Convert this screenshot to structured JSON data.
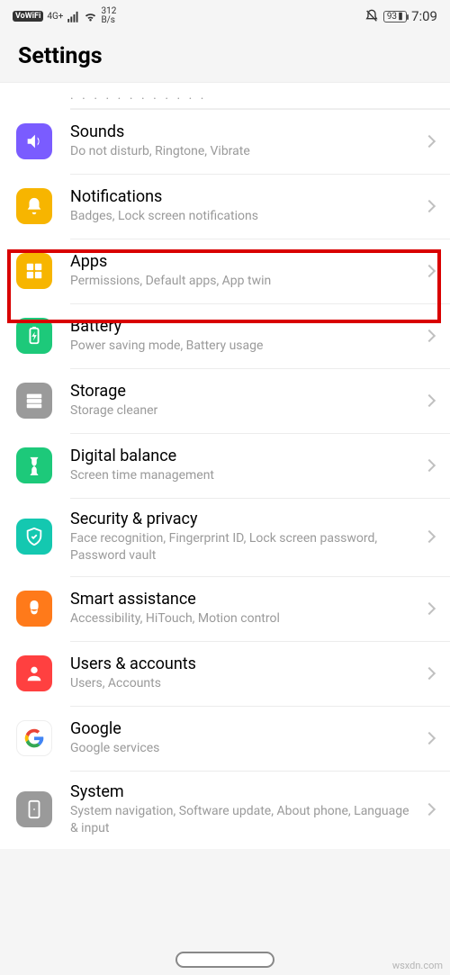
{
  "status": {
    "vowifi": "VoWiFi",
    "net": "4G+",
    "speed_num": "312",
    "speed_unit": "B/s",
    "battery": "93",
    "time": "7:09"
  },
  "header": {
    "title": "Settings"
  },
  "rows": [
    {
      "title": "Sounds",
      "sub": "Do not disturb, Ringtone, Vibrate",
      "color": "#7a5cff"
    },
    {
      "title": "Notifications",
      "sub": "Badges, Lock screen notifications",
      "color": "#f7b500"
    },
    {
      "title": "Apps",
      "sub": "Permissions, Default apps, App twin",
      "color": "#f7b500"
    },
    {
      "title": "Battery",
      "sub": "Power saving mode, Battery usage",
      "color": "#1dc97a"
    },
    {
      "title": "Storage",
      "sub": "Storage cleaner",
      "color": "#9a9a9a"
    },
    {
      "title": "Digital balance",
      "sub": "Screen time management",
      "color": "#1dc97a"
    },
    {
      "title": "Security & privacy",
      "sub": "Face recognition, Fingerprint ID, Lock screen password, Password vault",
      "color": "#14c8b0"
    },
    {
      "title": "Smart assistance",
      "sub": "Accessibility, HiTouch, Motion control",
      "color": "#ff7a1a"
    },
    {
      "title": "Users & accounts",
      "sub": "Users, Accounts",
      "color": "#ff4040"
    },
    {
      "title": "Google",
      "sub": "Google services",
      "color": "#ffffff"
    },
    {
      "title": "System",
      "sub": "System navigation, Software update, About phone, Language & input",
      "color": "#9a9a9a"
    }
  ],
  "watermark": "wsxdn.com"
}
